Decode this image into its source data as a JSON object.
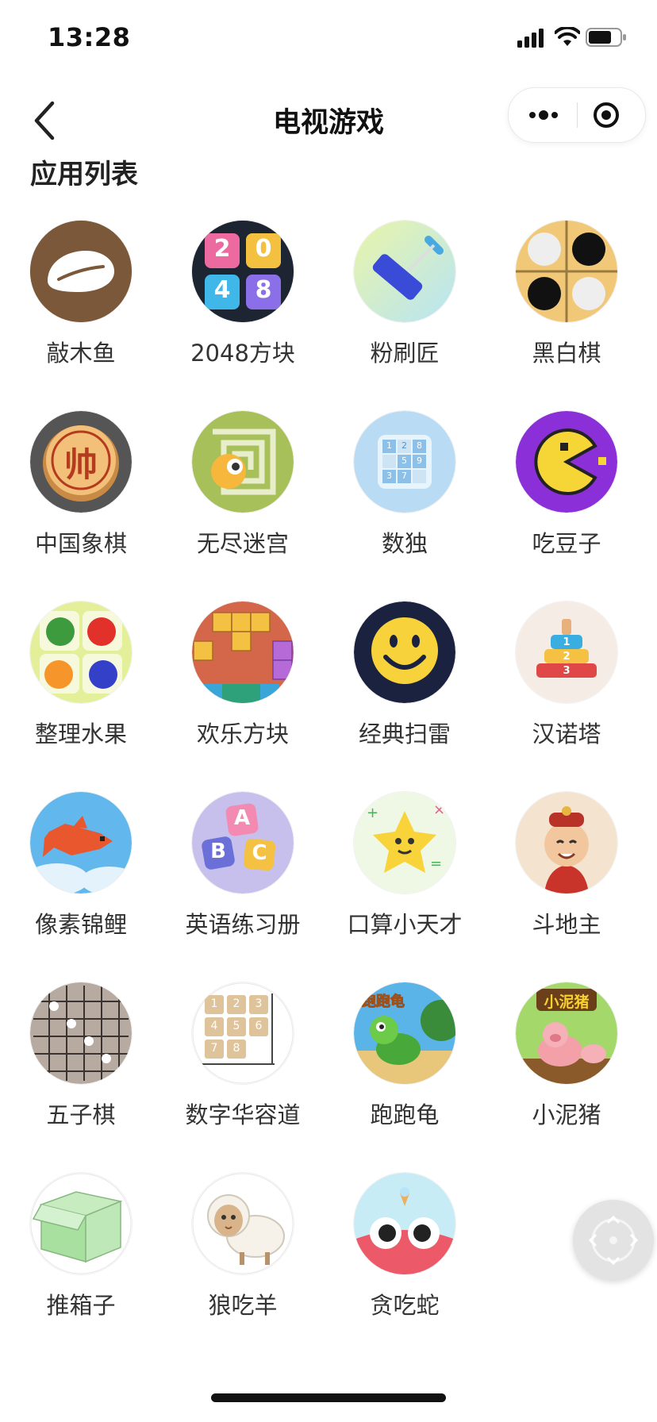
{
  "status_bar": {
    "time": "13:28"
  },
  "nav": {
    "title": "电视游戏"
  },
  "section": {
    "title": "应用列表"
  },
  "apps": [
    {
      "label": "敲木鱼",
      "icon": "wooden-fish-icon"
    },
    {
      "label": "2048方块",
      "icon": "2048-tiles-icon",
      "tiles": [
        "2",
        "0",
        "4",
        "8"
      ]
    },
    {
      "label": "粉刷匠",
      "icon": "paint-roller-icon"
    },
    {
      "label": "黑白棋",
      "icon": "reversi-stones-icon"
    },
    {
      "label": "中国象棋",
      "icon": "chinese-chess-piece-icon",
      "glyph": "帅"
    },
    {
      "label": "无尽迷宫",
      "icon": "maze-icon"
    },
    {
      "label": "数独",
      "icon": "sudoku-grid-icon",
      "digits": [
        "1",
        "2",
        "8",
        "5",
        "9",
        "3",
        "7"
      ]
    },
    {
      "label": "吃豆子",
      "icon": "pacman-icon"
    },
    {
      "label": "整理水果",
      "icon": "fruits-icon"
    },
    {
      "label": "欢乐方块",
      "icon": "block-puzzle-icon"
    },
    {
      "label": "经典扫雷",
      "icon": "smiley-face-icon"
    },
    {
      "label": "汉诺塔",
      "icon": "hanoi-tower-icon",
      "disks": [
        "1",
        "2",
        "3"
      ]
    },
    {
      "label": "像素锦鲤",
      "icon": "pixel-koi-fish-icon"
    },
    {
      "label": "英语练习册",
      "icon": "abc-blocks-icon",
      "letters": [
        "A",
        "B",
        "C"
      ]
    },
    {
      "label": "口算小天才",
      "icon": "math-star-icon"
    },
    {
      "label": "斗地主",
      "icon": "landlord-character-icon"
    },
    {
      "label": "五子棋",
      "icon": "gomoku-board-icon"
    },
    {
      "label": "数字华容道",
      "icon": "number-slide-puzzle-icon",
      "numbers": [
        "1",
        "2",
        "3",
        "4",
        "5",
        "6",
        "7",
        "8"
      ]
    },
    {
      "label": "跑跑龟",
      "icon": "running-turtle-icon",
      "badge": "跑跑龟"
    },
    {
      "label": "小泥猪",
      "icon": "muddy-pig-icon",
      "badge": "小泥猪"
    },
    {
      "label": "推箱子",
      "icon": "box-icon"
    },
    {
      "label": "狼吃羊",
      "icon": "sheep-icon"
    },
    {
      "label": "贪吃蛇",
      "icon": "snake-face-icon"
    }
  ]
}
